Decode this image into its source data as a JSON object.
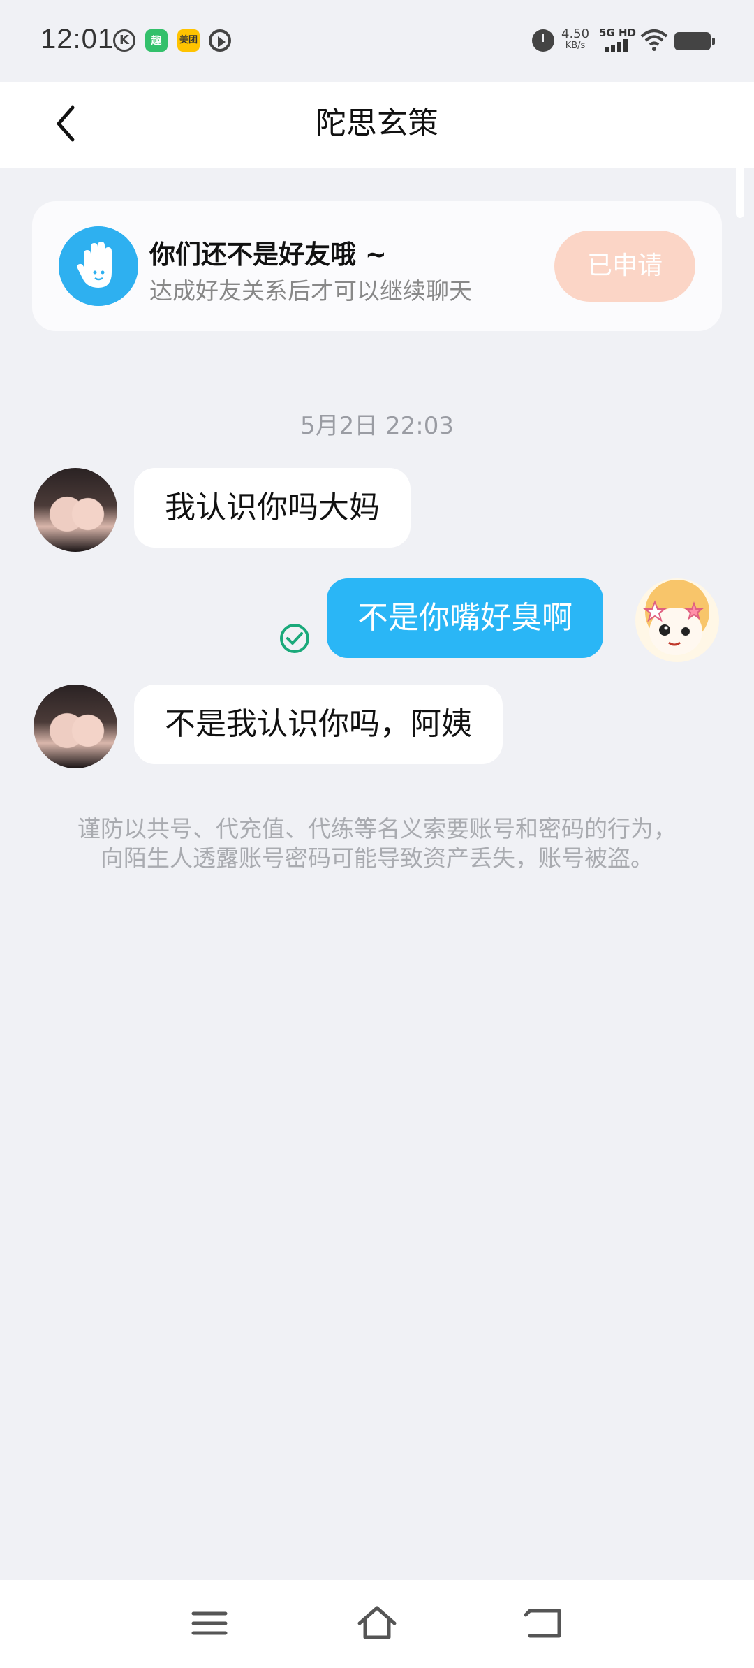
{
  "status_bar": {
    "time": "12:01",
    "app_icons": [
      {
        "name": "k-icon",
        "text": "K"
      },
      {
        "name": "qutoutiao-icon",
        "text": "趣"
      },
      {
        "name": "meituan-icon",
        "text": "美团"
      },
      {
        "name": "play-icon",
        "text": ""
      }
    ],
    "net_speed_value": "4.50",
    "net_speed_unit": "KB/s",
    "network": "5G HD",
    "colors": {
      "icon": "#444444"
    }
  },
  "header": {
    "title": "陀思玄策"
  },
  "friend_card": {
    "title": "你们还不是好友哦 ~",
    "subtitle": "达成好友关系后才可以继续聊天",
    "button_label": "已申请",
    "colors": {
      "icon_bg": "#2eb0f0",
      "button_bg": "#fbd5c6"
    }
  },
  "chat": {
    "timestamp": "5月2日 22:03",
    "messages": [
      {
        "direction": "incoming",
        "text": "我认识你吗大妈"
      },
      {
        "direction": "outgoing",
        "text": "不是你嘴好臭啊",
        "status": "read"
      },
      {
        "direction": "incoming",
        "text": "不是我认识你吗，阿姨"
      }
    ],
    "colors": {
      "outgoing_bubble": "#2ab6f6",
      "incoming_bubble": "#ffffff",
      "read_check": "#1aa97a"
    }
  },
  "notice": "谨防以共号、代充值、代练等名义索要账号和密码的行为，向陌生人透露账号密码可能导致资产丢失，账号被盗。",
  "nav_bar": {
    "items": [
      "menu-icon",
      "home-icon",
      "back-icon"
    ]
  }
}
